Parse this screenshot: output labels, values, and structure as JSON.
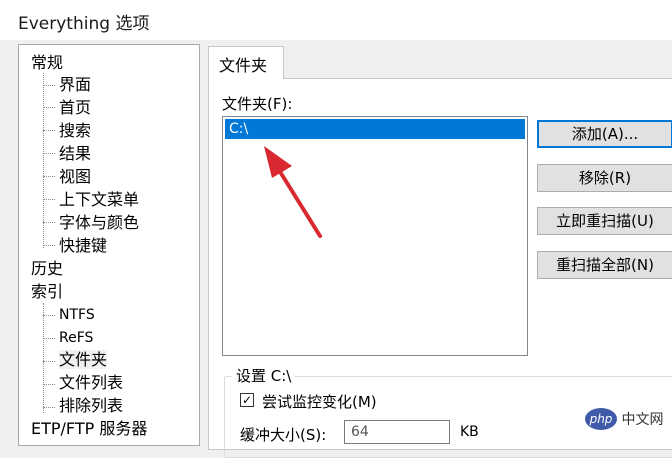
{
  "window": {
    "title": "Everything 选项"
  },
  "tree": {
    "general": "常规",
    "general_children": [
      "界面",
      "首页",
      "搜索",
      "结果",
      "视图",
      "上下文菜单",
      "字体与颜色",
      "快捷键"
    ],
    "history": "历史",
    "index": "索引",
    "index_children": [
      "NTFS",
      "ReFS",
      "文件夹",
      "文件列表",
      "排除列表"
    ],
    "ftp": "ETP/FTP 服务器"
  },
  "tab": {
    "label": "文件夹"
  },
  "folders": {
    "label": "文件夹(F):",
    "items": [
      "C:\\"
    ],
    "selected_color": "#0078d7"
  },
  "buttons": {
    "add": "添加(A)...",
    "remove": "移除(R)",
    "rescan_now": "立即重扫描(U)",
    "rescan_all": "重扫描全部(N)"
  },
  "settings": {
    "title": "设置 C:\\",
    "monitor_label": "尝试监控变化(M)",
    "monitor_checked": true,
    "buffer_label": "缓冲大小(S):",
    "buffer_value": "64",
    "buffer_unit": "KB"
  },
  "watermark": {
    "logo": "php",
    "text": "中文网"
  },
  "annotation": {
    "arrow_color": "#d9282f"
  }
}
